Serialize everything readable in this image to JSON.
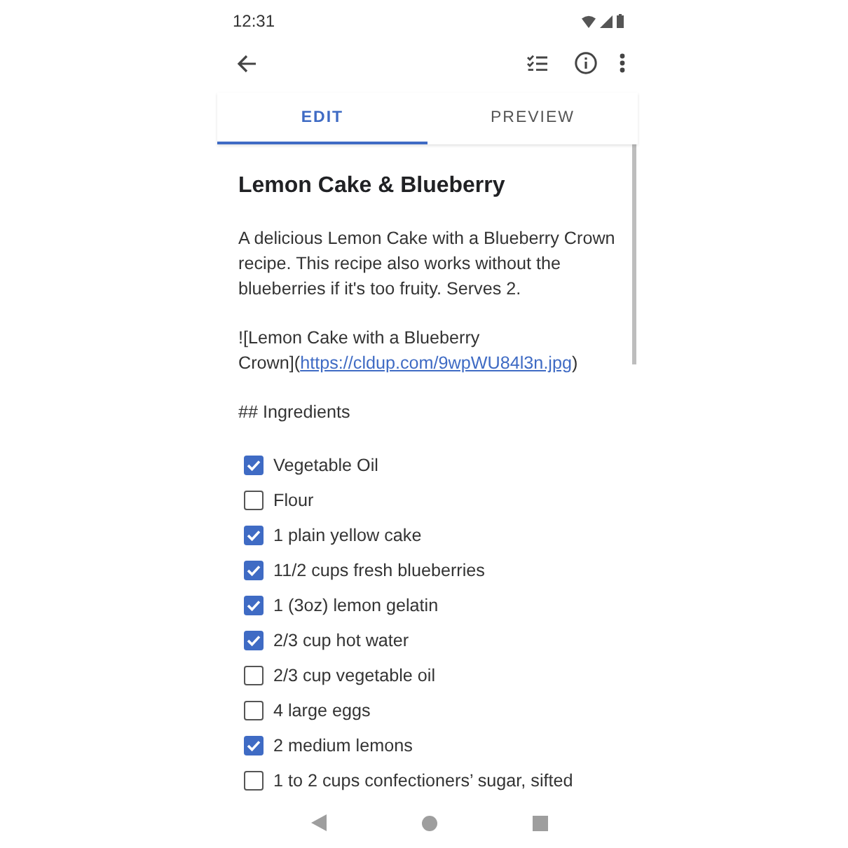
{
  "status_bar": {
    "time": "12:31"
  },
  "tabs": [
    {
      "label": "EDIT",
      "selected": true
    },
    {
      "label": "PREVIEW",
      "selected": false
    }
  ],
  "note": {
    "title": "Lemon Cake & Blueberry",
    "description": "A delicious Lemon Cake with a Blueberry Crown recipe. This recipe also works without the blueberries if it's too fruity. Serves 2.",
    "image_markup": {
      "prefix": "![Lemon Cake with a Blueberry Crown](",
      "url": "https://cldup.com/9wpWU84l3n.jpg",
      "suffix": ")"
    },
    "heading": "## Ingredients",
    "checklist": [
      {
        "label": "Vegetable Oil",
        "checked": true
      },
      {
        "label": "Flour",
        "checked": false
      },
      {
        "label": "1 plain yellow cake",
        "checked": true
      },
      {
        "label": "11/2 cups fresh blueberries",
        "checked": true
      },
      {
        "label": "1 (3oz) lemon gelatin",
        "checked": true
      },
      {
        "label": "2/3 cup hot water",
        "checked": true
      },
      {
        "label": "2/3 cup vegetable oil",
        "checked": false
      },
      {
        "label": "4 large eggs",
        "checked": false
      },
      {
        "label": "2 medium lemons",
        "checked": true
      },
      {
        "label": "1 to 2 cups confectioners’ sugar, sifted",
        "checked": false
      }
    ]
  }
}
